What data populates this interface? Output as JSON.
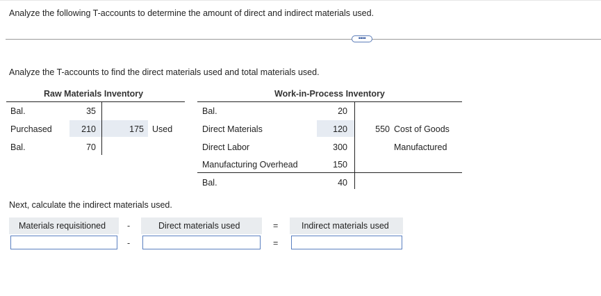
{
  "prompt": "Analyze the following T-accounts to determine the amount of direct and indirect materials used.",
  "more_button": "••••",
  "subprompt": "Analyze the T-accounts to find the direct materials used and total materials used.",
  "raw_materials": {
    "title": "Raw Materials Inventory",
    "debit_rows": [
      {
        "label": "Bal.",
        "value": "35"
      },
      {
        "label": "Purchased",
        "value": "210"
      },
      {
        "label": "Bal.",
        "value": "70"
      }
    ],
    "credit_rows": [
      {
        "value": "175",
        "label": "Used"
      }
    ]
  },
  "wip": {
    "title": "Work-in-Process Inventory",
    "debit_rows": [
      {
        "label": "Bal.",
        "value": "20"
      },
      {
        "label": "Direct Materials",
        "value": "120"
      },
      {
        "label": "Direct Labor",
        "value": "300"
      },
      {
        "label": "Manufacturing Overhead",
        "value": "150"
      },
      {
        "label": "Bal.",
        "value": "40"
      }
    ],
    "credit_rows": [
      {
        "value": "550",
        "label_line1": "Cost of Goods",
        "label_line2": "Manufactured"
      }
    ]
  },
  "next_instruction": "Next, calculate the indirect materials used.",
  "calc": {
    "labels": [
      "Materials requisitioned",
      "Direct materials used",
      "Indirect materials used"
    ],
    "operators": [
      "-",
      "="
    ],
    "inputs": [
      "",
      "",
      ""
    ]
  }
}
